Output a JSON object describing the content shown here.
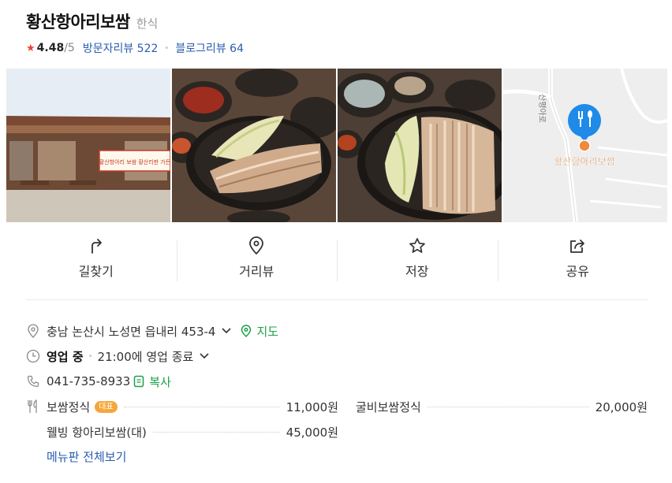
{
  "place": {
    "name": "황산항아리보쌈",
    "category": "한식",
    "rating": "4.48",
    "rating_max": "/5",
    "visitor_reviews": "방문자리뷰 522",
    "blog_reviews": "블로그리뷰 64"
  },
  "gallery": {
    "storefront_banner": "황산항아리 보쌈 황산리판 가든",
    "map_place_label": "황산항아리보쌈",
    "map_road_label": "산평아로"
  },
  "actions": [
    {
      "label": "길찾기",
      "icon": "directions-icon"
    },
    {
      "label": "거리뷰",
      "icon": "location-pin-icon"
    },
    {
      "label": "저장",
      "icon": "star-icon"
    },
    {
      "label": "공유",
      "icon": "share-icon"
    }
  ],
  "info": {
    "address": "충남 논산시 노성면 읍내리 453-4",
    "map_link": "지도",
    "status": "영업 중",
    "hours": "21:00에 영업 종료",
    "phone": "041-735-8933",
    "copy_label": "복사"
  },
  "menu": {
    "items": [
      {
        "name": "보쌈정식",
        "badge": "대표",
        "price": "11,000원"
      },
      {
        "name": "굴비보쌈정식",
        "price": "20,000원"
      },
      {
        "name": "웰빙 항아리보쌈(대)",
        "price": "45,000원"
      }
    ],
    "view_all": "메뉴판 전체보기"
  },
  "colors": {
    "accent_blue": "#2a5db0",
    "green": "#1aa14a",
    "star_red": "#f0412b",
    "badge_orange": "#f6a63a",
    "map_pin_blue": "#1f8ae8"
  }
}
